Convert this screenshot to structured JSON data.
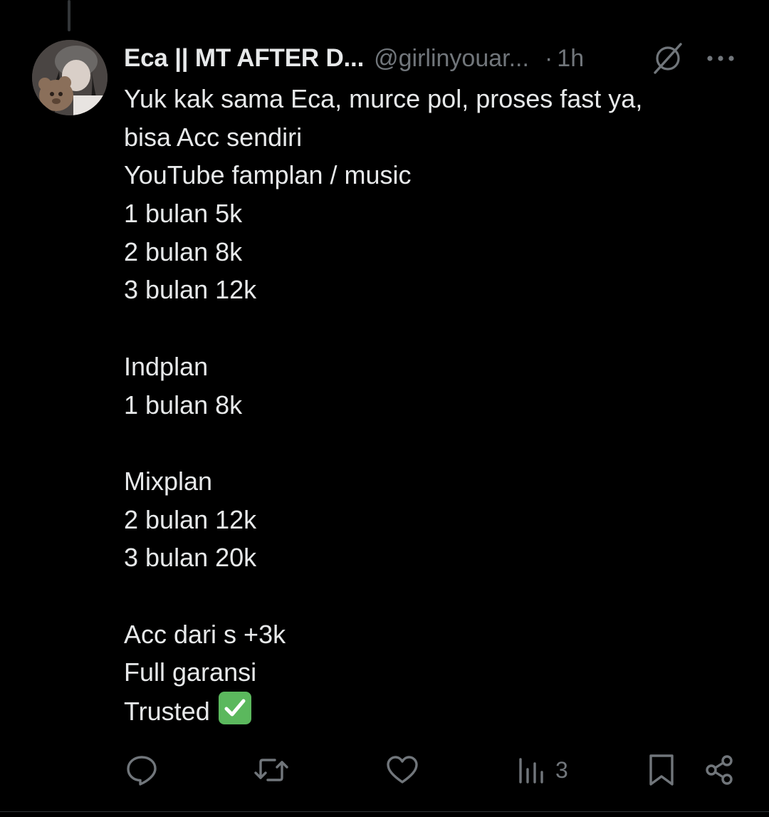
{
  "tweet": {
    "author": {
      "display_name": "Eca || MT AFTER D...",
      "handle": "@girlinyouar...",
      "avatar_icon": "avatar-photo"
    },
    "separator": "·",
    "time": "1h",
    "lines": [
      "Yuk  kak sama Eca, murce pol, proses fast ya,",
      "bisa Acc sendiri",
      "YouTube famplan / music",
      "1 bulan 5k",
      "2 bulan 8k",
      "3 bulan 12k",
      "",
      "Indplan",
      "1 bulan 8k",
      "",
      "Mixplan",
      "2 bulan 12k",
      "3 bulan 20k",
      "",
      "Acc dari s +3k",
      "Full garansi",
      "Trusted"
    ],
    "trailing_emoji": "check-mark-button-emoji"
  },
  "actions": {
    "reply_icon": "reply-icon",
    "retweet_icon": "retweet-icon",
    "like_icon": "heart-icon",
    "views_icon": "views-chart-icon",
    "views_count": "3",
    "bookmark_icon": "bookmark-icon",
    "share_icon": "share-icon"
  },
  "colors": {
    "background": "#000000",
    "text_primary": "#e7e9ea",
    "text_secondary": "#71767b",
    "emoji_green": "#5bb85d"
  }
}
